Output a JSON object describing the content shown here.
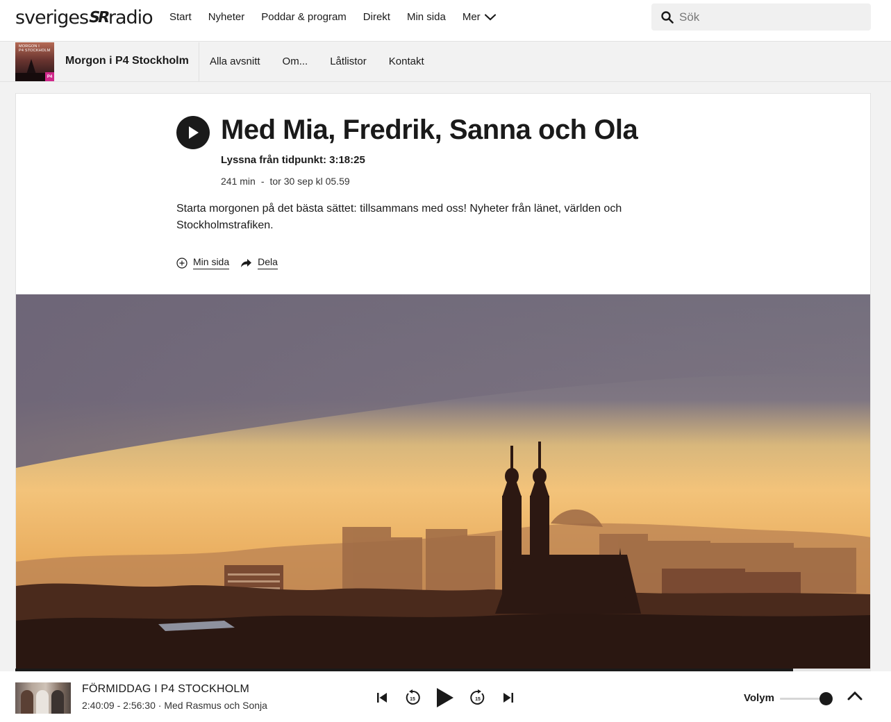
{
  "header": {
    "logo_left": "sveriges",
    "logo_mid": "SR",
    "logo_right": "radio",
    "nav": [
      "Start",
      "Nyheter",
      "Poddar & program",
      "Direkt",
      "Min sida"
    ],
    "more_label": "Mer",
    "search_placeholder": "Sök"
  },
  "program": {
    "thumb_text_line1": "MORGON I",
    "thumb_text_line2": "P4 STOCKHOLM",
    "thumb_badge": "P4",
    "title": "Morgon i P4 Stockholm",
    "tabs": [
      "Alla avsnitt",
      "Om...",
      "Låtlistor",
      "Kontakt"
    ]
  },
  "episode": {
    "title": "Med Mia, Fredrik, Sanna och Ola",
    "listen_from": "Lyssna från tidpunkt: 3:18:25",
    "duration": "241 min",
    "separator": "-",
    "date": "tor 30 sep kl 05.59",
    "description": "Starta morgonen på det bästa sättet: tillsammans med oss! Nyheter från länet, världen och Stockholmstrafiken.",
    "actions": {
      "my_page": "Min sida",
      "share": "Dela"
    }
  },
  "player": {
    "title": "FÖRMIDDAG I P4 STOCKHOLM",
    "time_range": "2:40:09 - 2:56:30",
    "dot": "·",
    "subtitle": "Med Rasmus och Sonja",
    "progress": 0.909,
    "skip_seconds": "15",
    "volume_label": "Volym",
    "volume": 1.0
  },
  "colors": {
    "text": "#1a1a1a",
    "background": "#f2f2f2",
    "card": "#ffffff",
    "accent_badge": "#d0288a"
  },
  "icons": {
    "search": "search-icon",
    "chevron": "chevron-down-icon",
    "play": "play-icon",
    "add": "add-circle-icon",
    "share": "share-arrow-icon",
    "prev": "skip-previous-icon",
    "rewind": "rewind-15-icon",
    "forward": "forward-15-icon",
    "next": "skip-next-icon",
    "expand": "chevron-up-icon"
  }
}
